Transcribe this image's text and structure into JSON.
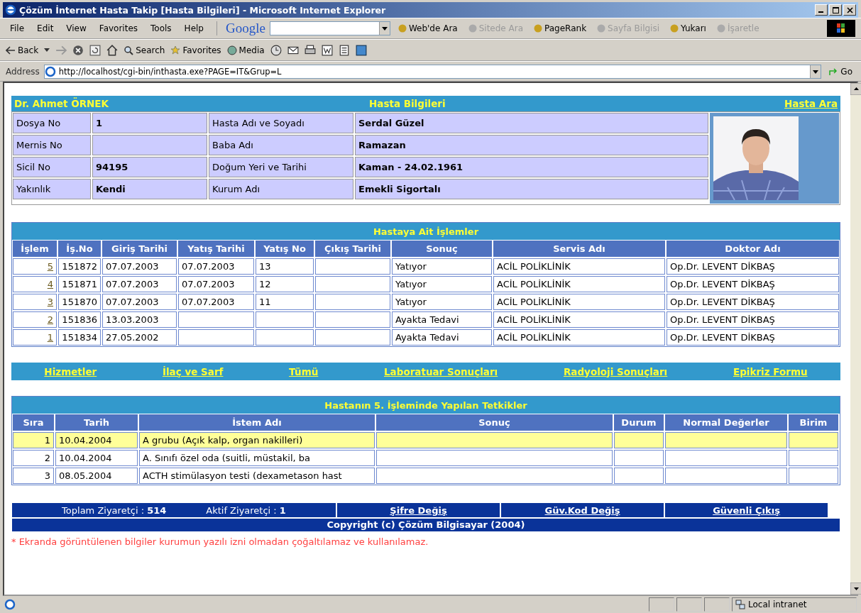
{
  "window": {
    "title": "Çözüm İnternet Hasta Takip [Hasta Bilgileri] - Microsoft Internet Explorer"
  },
  "menu": [
    "File",
    "Edit",
    "View",
    "Favorites",
    "Tools",
    "Help"
  ],
  "google_toolbar": {
    "logo": "Google",
    "items": [
      {
        "label": "Web'de Ara",
        "disabled": false
      },
      {
        "label": "Sitede Ara",
        "disabled": true
      },
      {
        "label": "PageRank",
        "disabled": false
      },
      {
        "label": "Sayfa Bilgisi",
        "disabled": true
      },
      {
        "label": "Yukarı",
        "disabled": false
      },
      {
        "label": "İşaretle",
        "disabled": true
      }
    ]
  },
  "nav_toolbar": [
    "Back",
    "Search",
    "Favorites",
    "Media"
  ],
  "address": {
    "label": "Address",
    "url": "http://localhost/cgi-bin/inthasta.exe?PAGE=IT&Grup=L",
    "go": "Go"
  },
  "patient": {
    "doctor": "Dr. Ahmet ÖRNEK",
    "title": "Hasta Bilgileri",
    "search_link": "Hasta Ara",
    "rows": [
      {
        "label_1": "Dosya No",
        "value_1": "1",
        "label_2": "Hasta Adı ve Soyadı",
        "value_2": "Serdal Güzel"
      },
      {
        "label_1": "Mernis No",
        "value_1": "",
        "label_2": "Baba Adı",
        "value_2": "Ramazan"
      },
      {
        "label_1": "Sicil No",
        "value_1": "94195",
        "label_2": "Doğum Yeri ve Tarihi",
        "value_2": "Kaman - 24.02.1961"
      },
      {
        "label_1": "Yakınlık",
        "value_1": "Kendi",
        "label_2": "Kurum Adı",
        "value_2": "Emekli Sigortalı"
      }
    ]
  },
  "procedures": {
    "title": "Hastaya Ait İşlemler",
    "columns": [
      "İşlem",
      "İş.No",
      "Giriş Tarihi",
      "Yatış Tarihi",
      "Yatış No",
      "Çıkış Tarihi",
      "Sonuç",
      "Servis Adı",
      "Doktor Adı"
    ],
    "rows": [
      [
        "5",
        "151872",
        "07.07.2003",
        "07.07.2003",
        "13",
        "",
        "Yatıyor",
        "ACİL POLİKLİNİK",
        "Op.Dr. LEVENT DİKBAŞ"
      ],
      [
        "4",
        "151871",
        "07.07.2003",
        "07.07.2003",
        "12",
        "",
        "Yatıyor",
        "ACİL POLİKLİNİK",
        "Op.Dr. LEVENT DİKBAŞ"
      ],
      [
        "3",
        "151870",
        "07.07.2003",
        "07.07.2003",
        "11",
        "",
        "Yatıyor",
        "ACİL POLİKLİNİK",
        "Op.Dr. LEVENT DİKBAŞ"
      ],
      [
        "2",
        "151836",
        "13.03.2003",
        "",
        "",
        "",
        "Ayakta Tedavi",
        "ACİL POLİKLİNİK",
        "Op.Dr. LEVENT DİKBAŞ"
      ],
      [
        "1",
        "151834",
        "27.05.2002",
        "",
        "",
        "",
        "Ayakta Tedavi",
        "ACİL POLİKLİNİK",
        "Op.Dr. LEVENT DİKBAŞ"
      ]
    ]
  },
  "links": [
    "Hizmetler",
    "İlaç ve Sarf",
    "Tümü",
    "Laboratuar Sonuçları",
    "Radyoloji Sonuçları",
    "Epikriz Formu"
  ],
  "tests": {
    "title": "Hastanın 5. İşleminde Yapılan Tetkikler",
    "columns": [
      "Sıra",
      "Tarih",
      "İstem Adı",
      "Sonuç",
      "Durum",
      "Normal Değerler",
      "Birim"
    ],
    "rows": [
      {
        "selected": true,
        "cells": [
          "1",
          "10.04.2004",
          "A grubu (Açık kalp, organ nakilleri)",
          "",
          "",
          "",
          ""
        ]
      },
      {
        "selected": false,
        "cells": [
          "2",
          "10.04.2004",
          "A. Sınıfı özel oda (suitli, müstakil, ba",
          "",
          "",
          "",
          ""
        ]
      },
      {
        "selected": false,
        "cells": [
          "3",
          "08.05.2004",
          "ACTH stimülasyon testi (dexametason hast",
          "",
          "",
          "",
          ""
        ]
      }
    ]
  },
  "footer": {
    "total_label": "Toplam Ziyaretçi :",
    "total": "514",
    "active_label": "Aktif Ziyaretçi :",
    "active": "1",
    "links": [
      "Şifre Değiş",
      "Güv.Kod Değiş",
      "Güvenli Çıkış"
    ],
    "copyright": "Copyright (c) Çözüm Bilgisayar (2004)",
    "notice": "* Ekranda görüntülenen bilgiler kurumun yazılı izni olmadan çoğaltılamaz ve kullanılamaz."
  },
  "status_bar": {
    "zone": "Local intranet"
  }
}
